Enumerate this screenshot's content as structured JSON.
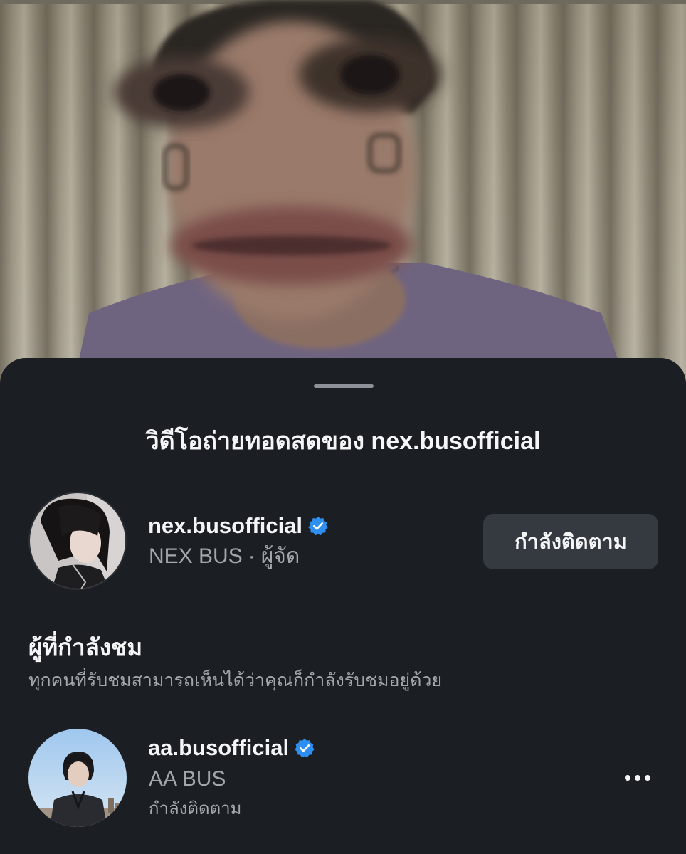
{
  "sheet": {
    "title": "วิดีโอถ่ายทอดสดของ nex.busofficial"
  },
  "host": {
    "username": "nex.busofficial",
    "verified": true,
    "display_name": "NEX BUS",
    "separator": "·",
    "role": "ผู้จัด",
    "follow_button_label": "กำลังติดตาม"
  },
  "viewers_section": {
    "title": "ผู้ที่กำลังชม",
    "subtitle": "ทุกคนที่รับชมสามารถเห็นได้ว่าคุณก็กำลังรับชมอยู่ด้วย",
    "viewers": [
      {
        "username": "aa.busofficial",
        "verified": true,
        "display_name": "AA BUS",
        "status": "กำลังติดตาม"
      }
    ]
  },
  "icons": {
    "verified": "verified-badge-icon",
    "more": "more-options-icon"
  },
  "colors": {
    "sheet_background": "#1b1e22",
    "primary_text": "#f4f5f6",
    "secondary_text": "#a3a7ad",
    "button_background": "#353940",
    "verified_blue": "#2f8ff0"
  }
}
